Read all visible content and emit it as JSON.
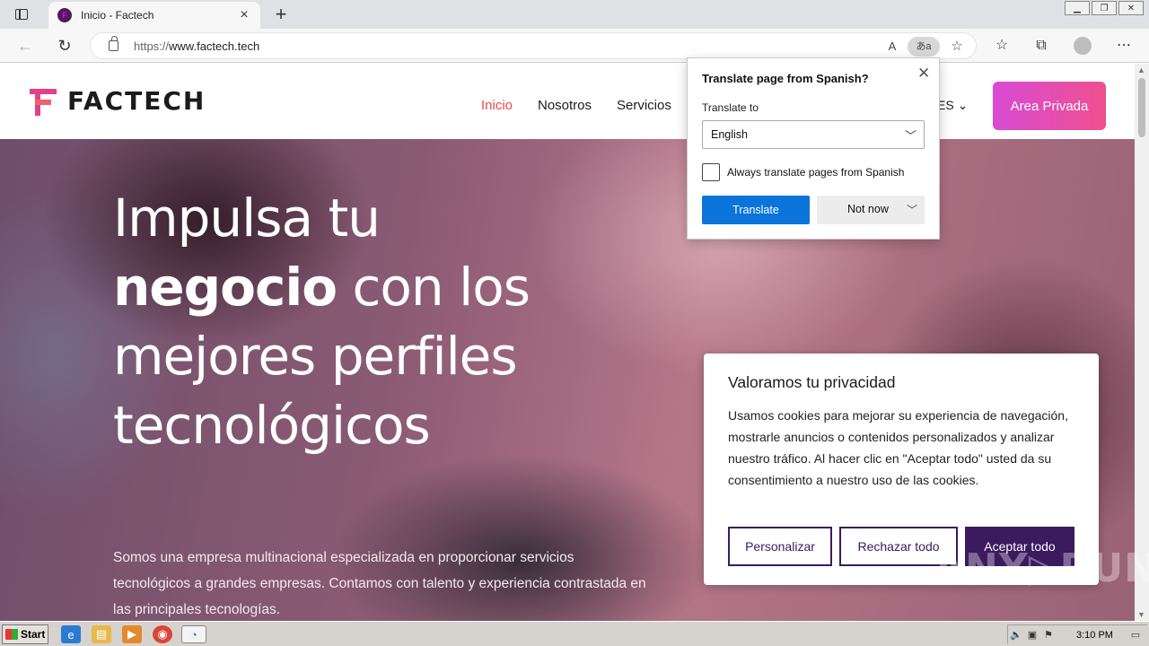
{
  "browser": {
    "tab_title": "Inicio - Factech",
    "tab_favicon": "F",
    "url_prefix": "https://",
    "url_host": "www.factech.tech",
    "icons": {
      "tab_actions": "tab-actions-icon",
      "close": "×",
      "new_tab": "+",
      "back": "←",
      "refresh": "↻",
      "read_aloud": "A",
      "translate": "あa",
      "add_favorite": "☆",
      "favorites": "☆",
      "collections": "⧉",
      "more": "⋯"
    }
  },
  "site": {
    "logo_text": "FACTECH",
    "nav": [
      "Inicio",
      "Nosotros",
      "Servicios"
    ],
    "lang": "ES ⌄",
    "area_button": "Area Privada"
  },
  "hero": {
    "title_line1": "Impulsa tu",
    "title_line2_bold": "negocio",
    "title_line2_rest": " con los",
    "title_line3": "mejores perfiles",
    "title_line4": "tecnológicos",
    "subtitle": "Somos una empresa multinacional especializada en proporcionar servicios tecnológicos a grandes empresas. Contamos con talento y experiencia contrastada en las principales tecnologías."
  },
  "cookie": {
    "title": "Valoramos tu privacidad",
    "text": "Usamos cookies para mejorar su experiencia de navegación, mostrarle anuncios o contenidos personalizados y analizar nuestro tráfico. Al hacer clic en \"Aceptar todo\" usted da su consentimiento a nuestro uso de las cookies.",
    "buttons": [
      "Personalizar",
      "Rechazar todo",
      "Aceptar todo"
    ]
  },
  "translate": {
    "title": "Translate page from Spanish?",
    "label": "Translate to",
    "selected_language": "English",
    "always_label": "Always translate pages from Spanish",
    "always_checked": false,
    "translate_button": "Translate",
    "not_now_button": "Not now"
  },
  "watermark": "ANY▷RUN",
  "taskbar": {
    "start": "Start",
    "clock": "3:10 PM"
  },
  "colors": {
    "accent_nav": "#e94a4a",
    "area_gradient": [
      "#d94bd4",
      "#ef4f8e"
    ],
    "cookie_primary": "#3b1a5e",
    "translate_button": "#0a74da"
  }
}
